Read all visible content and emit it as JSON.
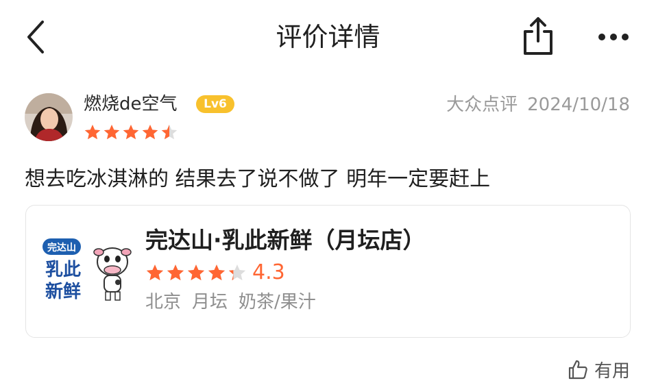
{
  "header": {
    "title": "评价详情",
    "back_icon": "back-arrow-icon",
    "share_icon": "share-icon",
    "more_icon": "more-icon"
  },
  "review": {
    "username": "燃烧de空气",
    "level": "Lv6",
    "source": "大众点评",
    "date": "2024/10/18",
    "rating": 4.5,
    "text": "想去吃冰淇淋的 结果去了说不做了 明年一定要赶上"
  },
  "shop": {
    "name": "完达山·乳此新鲜（月坛店）",
    "rating": 4.3,
    "score_label": "4.3",
    "city": "北京",
    "district": "月坛",
    "category": "奶茶/果汁",
    "logo_text_top": "完达山",
    "logo_text_line1": "乳此",
    "logo_text_line2": "新鲜"
  },
  "actions": {
    "useful_label": "有用"
  },
  "colors": {
    "star": "#ff6633",
    "star_empty": "#dddddd",
    "badge": "#f8c12d",
    "muted": "#9a9a9a"
  }
}
